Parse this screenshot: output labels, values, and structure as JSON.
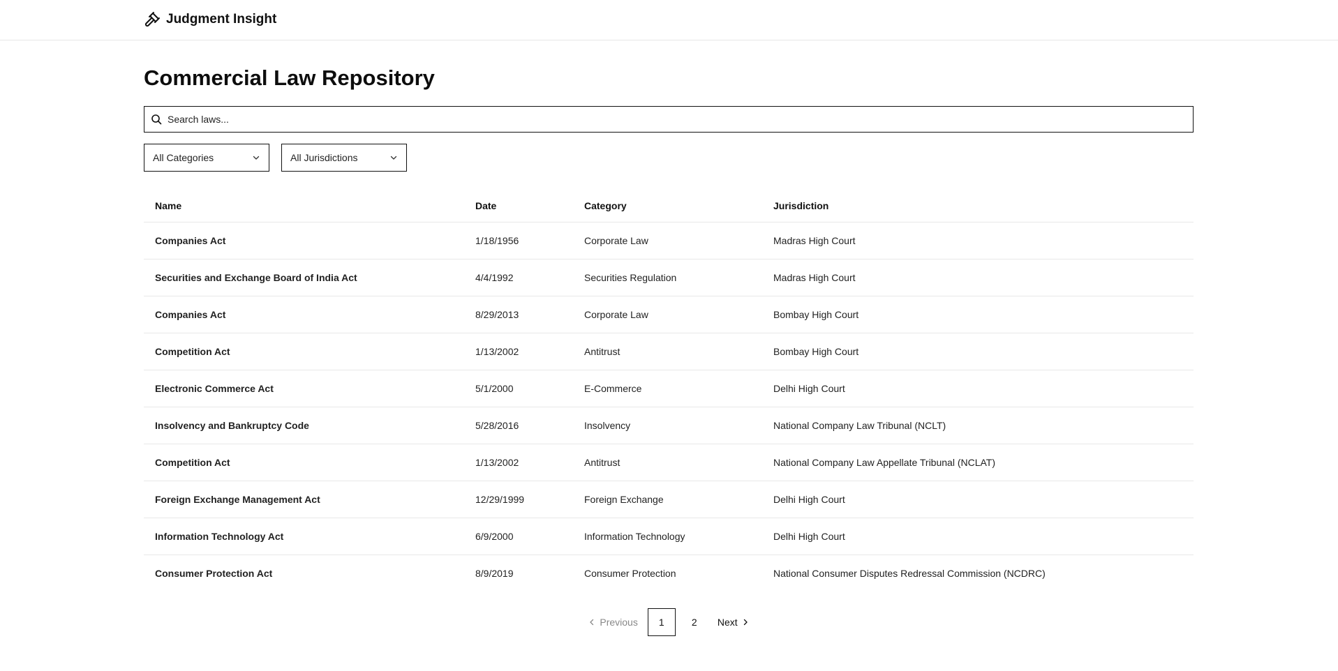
{
  "brand": {
    "name": "Judgment Insight",
    "icon": "gavel-icon"
  },
  "page": {
    "title": "Commercial Law Repository"
  },
  "search": {
    "placeholder": "Search laws...",
    "value": "",
    "icon": "search-icon"
  },
  "filters": {
    "category": {
      "selected": "All Categories"
    },
    "jurisdiction": {
      "selected": "All Jurisdictions"
    }
  },
  "table": {
    "headers": {
      "name": "Name",
      "date": "Date",
      "category": "Category",
      "jurisdiction": "Jurisdiction"
    },
    "rows": [
      {
        "name": "Companies Act",
        "date": "1/18/1956",
        "category": "Corporate Law",
        "jurisdiction": "Madras High Court"
      },
      {
        "name": "Securities and Exchange Board of India Act",
        "date": "4/4/1992",
        "category": "Securities Regulation",
        "jurisdiction": "Madras High Court"
      },
      {
        "name": "Companies Act",
        "date": "8/29/2013",
        "category": "Corporate Law",
        "jurisdiction": "Bombay High Court"
      },
      {
        "name": "Competition Act",
        "date": "1/13/2002",
        "category": "Antitrust",
        "jurisdiction": "Bombay High Court"
      },
      {
        "name": "Electronic Commerce Act",
        "date": "5/1/2000",
        "category": "E-Commerce",
        "jurisdiction": "Delhi High Court"
      },
      {
        "name": "Insolvency and Bankruptcy Code",
        "date": "5/28/2016",
        "category": "Insolvency",
        "jurisdiction": "National Company Law Tribunal (NCLT)"
      },
      {
        "name": "Competition Act",
        "date": "1/13/2002",
        "category": "Antitrust",
        "jurisdiction": "National Company Law Appellate Tribunal (NCLAT)"
      },
      {
        "name": "Foreign Exchange Management Act",
        "date": "12/29/1999",
        "category": "Foreign Exchange",
        "jurisdiction": "Delhi High Court"
      },
      {
        "name": "Information Technology Act",
        "date": "6/9/2000",
        "category": "Information Technology",
        "jurisdiction": "Delhi High Court"
      },
      {
        "name": "Consumer Protection Act",
        "date": "8/9/2019",
        "category": "Consumer Protection",
        "jurisdiction": "National Consumer Disputes Redressal Commission (NCDRC)"
      }
    ]
  },
  "pagination": {
    "previous": "Previous",
    "next": "Next",
    "pages": [
      "1",
      "2"
    ],
    "current": "1"
  }
}
